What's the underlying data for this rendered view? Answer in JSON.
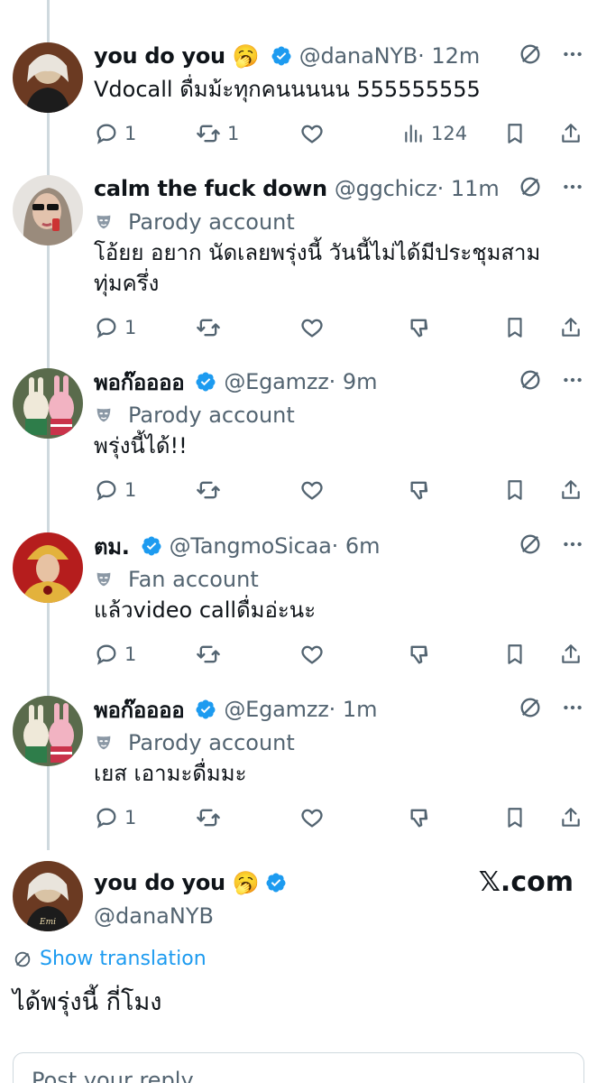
{
  "replies": [
    {
      "name": "you do you",
      "emoji": "🥱",
      "verified": true,
      "handle": "@danaNYB",
      "time": "· 12m",
      "label": "",
      "text_lines": [
        "Vdocall ดื่มม้ะทุกคนนนนน 555555555"
      ],
      "reply_count": "1",
      "retweet_count": "1",
      "views_count": "124",
      "avatar": "avatar-blonde"
    },
    {
      "name": "calm the fuck down",
      "emoji": "",
      "verified": false,
      "handle": "@ggchicz",
      "time": "· 11m",
      "label": "Parody account",
      "text_lines": [
        "โอ้ยย อยาก นัดเลยพรุ่งนี้ วันนี้ไม่ได้มีประชุมสาม",
        "ทุ่มครึ่ง"
      ],
      "reply_count": "1",
      "avatar": "avatar-sunglasses"
    },
    {
      "name": "พอก๊ออออ",
      "emoji": "",
      "verified": true,
      "handle": "@Egamzz",
      "time": "· 9m",
      "label": "Parody account",
      "text_lines": [
        "พรุ่งนี้ได้!!"
      ],
      "reply_count": "1",
      "avatar": "avatar-rabbits"
    },
    {
      "name": "ตม.",
      "emoji": "",
      "verified": true,
      "handle": "@TangmoSicaa",
      "time": "· 6m",
      "label": "Fan account",
      "text_lines": [
        "แล้วvideo callดื่มอ่ะนะ"
      ],
      "reply_count": "1",
      "avatar": "avatar-costume"
    },
    {
      "name": "พอก๊ออออ",
      "emoji": "",
      "verified": true,
      "handle": "@Egamzz",
      "time": "· 1m",
      "label": "Parody account",
      "text_lines": [
        "เยส เอามะดื่มมะ"
      ],
      "reply_count": "1",
      "avatar": "avatar-rabbits"
    }
  ],
  "main_tweet": {
    "name": "you do you",
    "emoji": "🥱",
    "handle": "@danaNYB",
    "brand": "𝕏.com",
    "show_translation": "Show translation",
    "text": "ได้พรุ่งนี้ กี่โมง"
  },
  "reply_box": {
    "placeholder": "Post your reply"
  },
  "colors": {
    "accent": "#1d9bf0",
    "secondary_text": "#536471",
    "verified": "#1d9bf0"
  }
}
